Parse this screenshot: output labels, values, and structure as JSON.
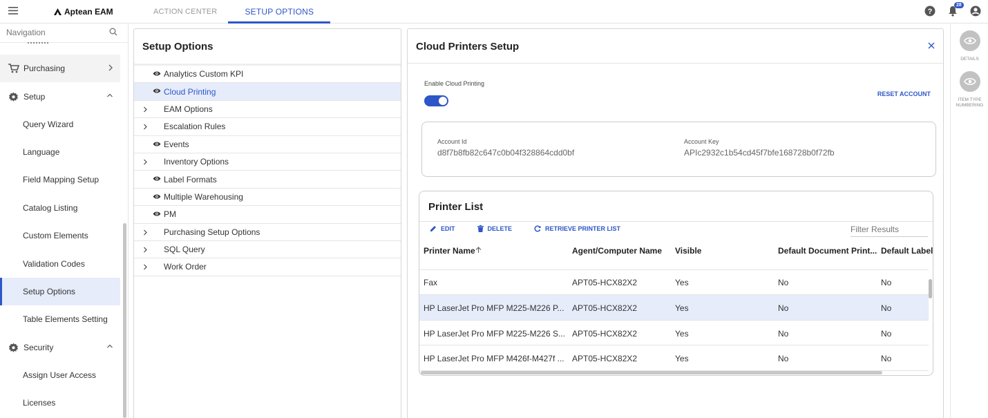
{
  "app": {
    "brand": "Aptean EAM"
  },
  "tabs": [
    {
      "label": "ACTION CENTER",
      "active": false
    },
    {
      "label": "SETUP OPTIONS",
      "active": true
    }
  ],
  "notifications": {
    "count": "28"
  },
  "nav": {
    "search_placeholder": "Navigation",
    "items": [
      {
        "label": "Purchasing",
        "type": "group"
      },
      {
        "label": "Setup",
        "type": "group"
      },
      {
        "label": "Query Wizard",
        "type": "sub"
      },
      {
        "label": "Language",
        "type": "sub"
      },
      {
        "label": "Field Mapping Setup",
        "type": "sub"
      },
      {
        "label": "Catalog Listing",
        "type": "sub"
      },
      {
        "label": "Custom Elements",
        "type": "sub"
      },
      {
        "label": "Validation Codes",
        "type": "sub"
      },
      {
        "label": "Setup Options",
        "type": "sub",
        "selected": true
      },
      {
        "label": "Table Elements Setting",
        "type": "sub"
      },
      {
        "label": "Security",
        "type": "group"
      },
      {
        "label": "Assign User Access",
        "type": "sub"
      },
      {
        "label": "Licenses",
        "type": "sub"
      }
    ]
  },
  "setup_panel": {
    "title": "Setup Options",
    "items": [
      {
        "label": "Analytics Custom KPI",
        "kind": "view"
      },
      {
        "label": "Cloud Printing",
        "kind": "view",
        "selected": true
      },
      {
        "label": "EAM Options",
        "kind": "expand"
      },
      {
        "label": "Escalation Rules",
        "kind": "expand"
      },
      {
        "label": "Events",
        "kind": "view"
      },
      {
        "label": "Inventory Options",
        "kind": "expand"
      },
      {
        "label": "Label Formats",
        "kind": "view"
      },
      {
        "label": "Multiple Warehousing",
        "kind": "view"
      },
      {
        "label": "PM",
        "kind": "view"
      },
      {
        "label": "Purchasing Setup Options",
        "kind": "expand"
      },
      {
        "label": "SQL Query",
        "kind": "expand"
      },
      {
        "label": "Work Order",
        "kind": "expand"
      }
    ]
  },
  "cloud_panel": {
    "title": "Cloud Printers Setup",
    "enable_label": "Enable Cloud Printing",
    "enabled": true,
    "reset_label": "RESET ACCOUNT",
    "account_id_label": "Account Id",
    "account_id": "d8f7b8fb82c647c0b04f328864cdd0bf",
    "account_key_label": "Account Key",
    "account_key": "APIc2932c1b54cd45f7bfe168728b0f72fb"
  },
  "printer_list": {
    "title": "Printer List",
    "toolbar": {
      "edit": "EDIT",
      "delete": "DELETE",
      "retrieve": "RETRIEVE PRINTER LIST"
    },
    "filter_placeholder": "Filter Results",
    "columns": [
      "Printer Name",
      "Agent/Computer Name",
      "Visible",
      "Default Document Print...",
      "Default Label I"
    ],
    "rows": [
      [
        "Fax",
        "APT05-HCX82X2",
        "Yes",
        "No",
        "No"
      ],
      [
        "HP LaserJet Pro MFP M225-M226 P...",
        "APT05-HCX82X2",
        "Yes",
        "No",
        "No"
      ],
      [
        "HP LaserJet Pro MFP M225-M226 S...",
        "APT05-HCX82X2",
        "Yes",
        "No",
        "No"
      ],
      [
        "HP LaserJet Pro MFP M426f-M427f ...",
        "APT05-HCX82X2",
        "Yes",
        "No",
        "No"
      ]
    ],
    "selected_row": 1
  },
  "right_rail": [
    {
      "label": "DETAILS",
      "icon": "eye-icon"
    },
    {
      "label": "ITEM TYPE NUMBERING",
      "icon": "eye-icon"
    }
  ],
  "colors": {
    "accent": "#2d56c8",
    "selected_bg": "#e6ecfa",
    "rail_circle": "#c2c2c2"
  }
}
